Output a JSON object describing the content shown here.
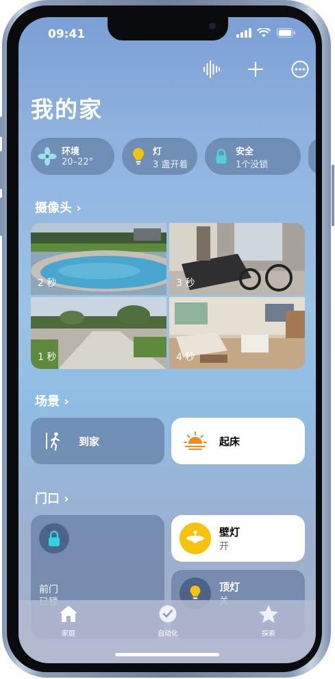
{
  "status_bar": {
    "time": "09:41"
  },
  "toolbar": {
    "voice_icon": "waveform-icon",
    "add_icon": "plus-icon",
    "more_icon": "ellipsis-circle-icon"
  },
  "header": {
    "title": "我的家"
  },
  "chips": [
    {
      "title": "环境",
      "subtitle": "20–22°",
      "icon": "fan-icon"
    },
    {
      "title": "灯",
      "subtitle": "3 盏开着",
      "icon": "bulb-icon"
    },
    {
      "title": "安全",
      "subtitle": "1个没锁",
      "icon": "lock-icon"
    }
  ],
  "cameras": {
    "title": "摄像头",
    "tiles": [
      {
        "label": "2 秒"
      },
      {
        "label": "3 秒"
      },
      {
        "label": "1 秒"
      },
      {
        "label": "4 秒"
      }
    ]
  },
  "scenes": {
    "title": "场景",
    "items": [
      {
        "label": "到家",
        "icon": "walking-person-icon"
      },
      {
        "label": "起床",
        "icon": "sunrise-icon"
      }
    ]
  },
  "doorway": {
    "title": "门口",
    "accessories": [
      {
        "name": "前门",
        "status": "已锁",
        "icon": "lock-icon"
      },
      {
        "name": "壁灯",
        "status": "开",
        "icon": "ceiling-fan-light-icon"
      },
      {
        "name": "顶灯",
        "status": "关",
        "icon": "bulb-icon"
      }
    ]
  },
  "tabbar": {
    "tabs": [
      {
        "label": "家庭",
        "icon": "house-icon",
        "selected": true
      },
      {
        "label": "自动化",
        "icon": "clock-icon",
        "selected": false
      },
      {
        "label": "探索",
        "icon": "star-icon",
        "selected": false
      }
    ]
  },
  "colors": {
    "accent_tint": "#2fb6c8",
    "light_yellow": "#f7c20a",
    "sunrise_orange": "#ef8a1f"
  }
}
